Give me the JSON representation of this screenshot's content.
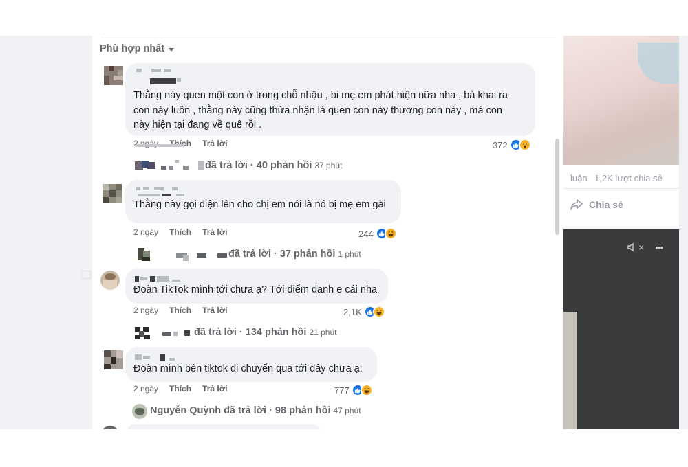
{
  "sort": {
    "label": "Phù hợp nhất"
  },
  "background_post": {
    "stats_left": "luận",
    "shares": "1,2K lượt chia sẻ",
    "share_button": "Chia sẻ",
    "mute_symbol": "×",
    "more_symbol": "•••"
  },
  "comments": [
    {
      "text": "Thằng này quen một con ở trong chỗ nhậu , bi mẹ em phát hiện nữa nha , bả khai ra\ncon này luôn , thằng này cũng thừa nhận là quen con này thương con này , mà con\nnày hiện tại đang về quê rồi .",
      "time": "2 ngày",
      "like": "Thích",
      "reply": "Trả lời",
      "reactions": "372",
      "replies": {
        "by": "đã trả lời",
        "summary": "40 phản hồi",
        "time": "37 phút"
      }
    },
    {
      "text": "Thằng này gọi điện lên cho chị em nói là nó bị mẹ em gài",
      "time": "2 ngày",
      "like": "Thích",
      "reply": "Trả lời",
      "reactions": "244",
      "replies": {
        "by": "đã trả lời",
        "summary": "37 phản hồi",
        "time": "1 phút"
      }
    },
    {
      "text": "Đoàn TikTok mình tới chưa ạ? Tới điểm danh e cái nha",
      "time": "2 ngày",
      "like": "Thích",
      "reply": "Trả lời",
      "reactions": "2,1K",
      "replies": {
        "by": "đã trả lời",
        "summary": "134 phản hồi",
        "time": "21 phút"
      }
    },
    {
      "text": "Đoàn mình bên tiktok di chuyển qua tới đây chưa ạ:",
      "time": "2 ngày",
      "like": "Thích",
      "reply": "Trả lời",
      "reactions": "777",
      "replies": {
        "name": "Nguyễn Quỳnh",
        "by": "đã trả lời",
        "summary": "98 phản hồi",
        "time": "47 phút"
      }
    }
  ],
  "sep": " · ",
  "colors": {
    "like": "#1b74e4",
    "emoji": "#f7b125",
    "bubble": "#f0f2f5",
    "secondary": "#65676b"
  }
}
